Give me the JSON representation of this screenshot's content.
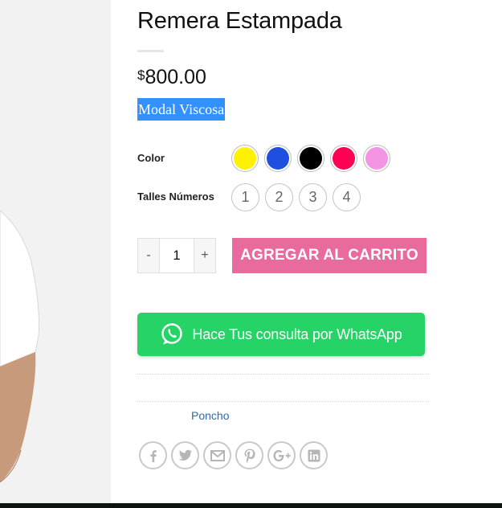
{
  "product": {
    "title": "Remera Estampada",
    "price_currency": "$",
    "price_amount": "800.00",
    "material": "Modal Viscosa"
  },
  "attributes": {
    "color_label": "Color",
    "colors": [
      {
        "name": "yellow",
        "hex": "#fff200"
      },
      {
        "name": "blue",
        "hex": "#1f4fe0"
      },
      {
        "name": "black",
        "hex": "#000000"
      },
      {
        "name": "crimson",
        "hex": "#ff0055"
      },
      {
        "name": "pink",
        "hex": "#f395e3"
      }
    ],
    "sizes_label": "Talles Números",
    "sizes": [
      "1",
      "2",
      "3",
      "4"
    ]
  },
  "cart": {
    "decrement": "-",
    "quantity": "1",
    "increment": "+",
    "add_to_cart": "AGREGAR AL CARRITO"
  },
  "whatsapp": {
    "label": "Hace Tus consulta por WhatsApp",
    "color": "#25d366"
  },
  "meta": {
    "category": "Poncho"
  },
  "share": {
    "icons": [
      "facebook-icon",
      "twitter-icon",
      "email-icon",
      "pinterest-icon",
      "google-plus-icon",
      "linkedin-icon"
    ]
  },
  "colors": {
    "accent_pink": "#e96a9c",
    "link_blue": "#2b6cb0",
    "selection_blue": "#3390ff"
  }
}
